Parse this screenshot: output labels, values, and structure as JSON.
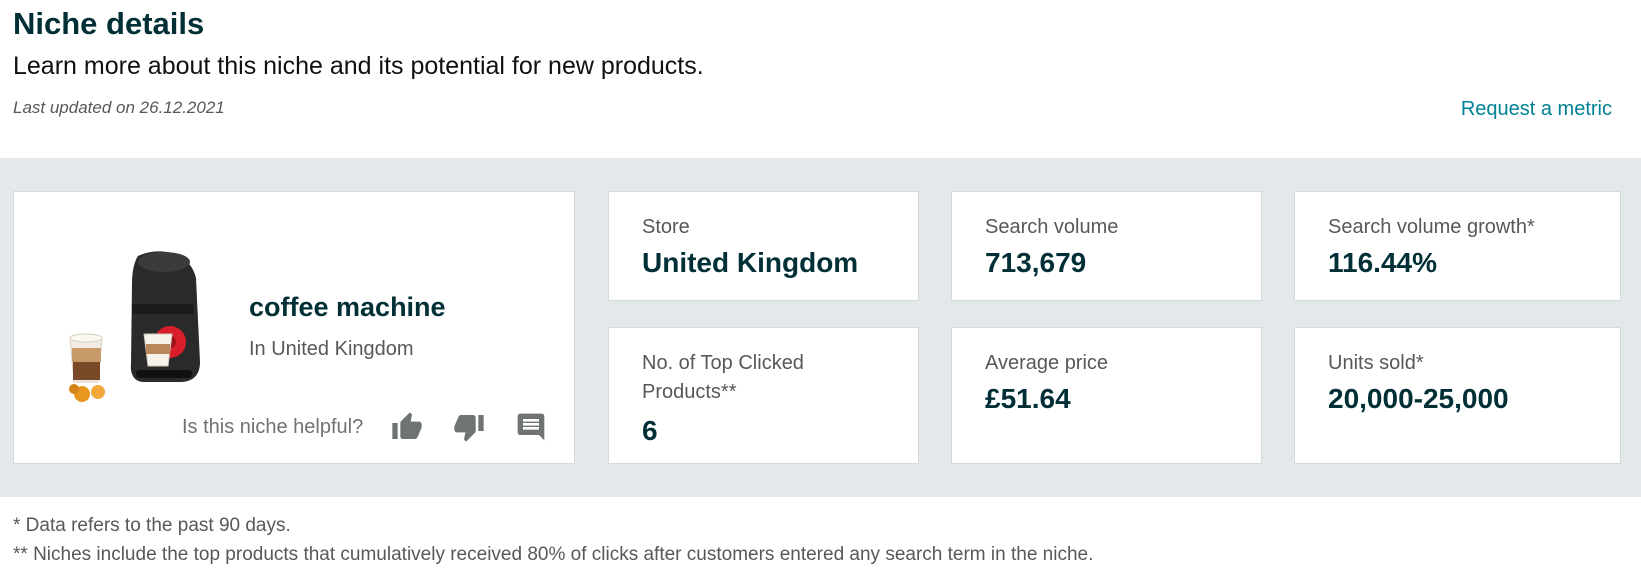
{
  "header": {
    "title": "Niche details",
    "subtitle": "Learn more about this niche and its potential for new products.",
    "last_updated": "Last updated on 26.12.2021",
    "request_metric": "Request a metric"
  },
  "niche": {
    "name": "coffee machine",
    "location": "In United Kingdom",
    "helpful_question": "Is this niche helpful?",
    "icons": [
      "thumbs-up-icon",
      "thumbs-down-icon",
      "comment-icon"
    ]
  },
  "metrics": [
    {
      "label": "Store",
      "value": "United Kingdom"
    },
    {
      "label": "Search volume",
      "value": "713,679"
    },
    {
      "label": "Search volume growth*",
      "value": "116.44%"
    },
    {
      "label": "No. of Top Clicked Products**",
      "value": "6"
    },
    {
      "label": "Average price",
      "value": "£51.64"
    },
    {
      "label": "Units sold*",
      "value": "20,000-25,000"
    }
  ],
  "footnotes": [
    "* Data refers to the past 90 days.",
    "** Niches include the top products that cumulatively received 80% of clicks after customers entered any search term in the niche."
  ],
  "colors": {
    "accent_link": "#008296",
    "heading": "#002f36",
    "band_background": "#e3e9ea",
    "muted_text": "#565959"
  }
}
